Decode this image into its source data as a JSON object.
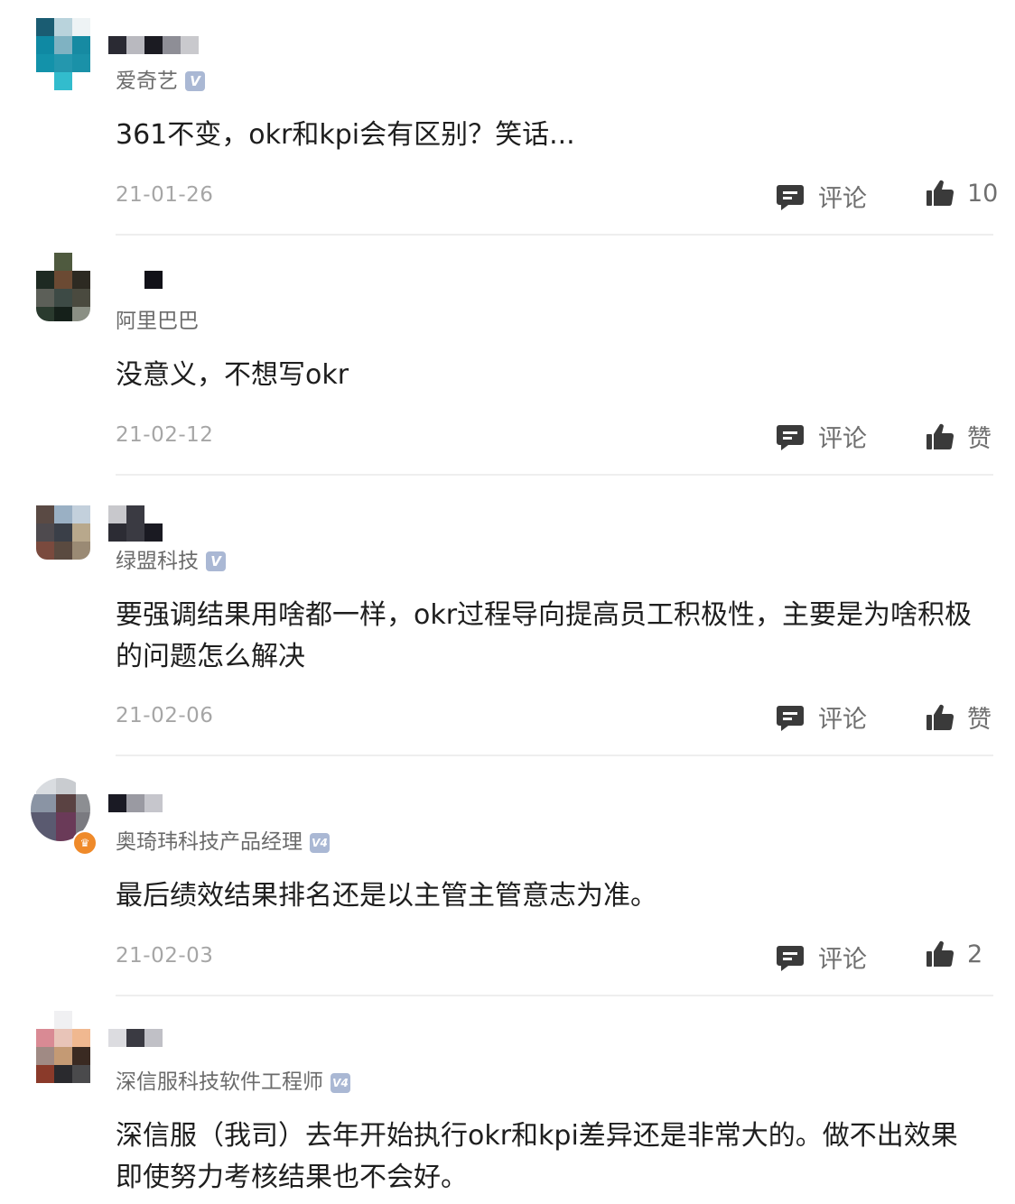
{
  "comments": [
    {
      "company": "爱奇艺",
      "badge": "V",
      "content": "361不变，okr和kpi会有区别？笑话...",
      "date": "21-01-26",
      "comment_label": "评论",
      "like_label": "10"
    },
    {
      "company": "阿里巴巴",
      "badge": "",
      "content": "没意义，不想写okr",
      "date": "21-02-12",
      "comment_label": "评论",
      "like_label": "赞"
    },
    {
      "company": "绿盟科技",
      "badge": "V",
      "content": "要强调结果用啥都一样，okr过程导向提高员工积极性，主要是为啥积极的问题怎么解决",
      "date": "21-02-06",
      "comment_label": "评论",
      "like_label": "赞"
    },
    {
      "company": "奥琦玮科技产品经理",
      "badge": "V4",
      "content": "最后绩效结果排名还是以主管主管意志为准。",
      "date": "21-02-03",
      "comment_label": "评论",
      "like_label": "2"
    },
    {
      "company": "深信服科技软件工程师",
      "badge": "V4",
      "content": "深信服（我司）去年开始执行okr和kpi差异还是非常大的。做不出效果即使努力考核结果也不会好。",
      "date": "",
      "comment_label": "",
      "like_label": ""
    }
  ],
  "colors": {
    "text": "#1e1e1e",
    "muted": "#6b6b6b",
    "date": "#a6a6a6",
    "badge": "#aab8d4",
    "divider": "#eeeeee"
  },
  "icons": {
    "comment": "comment-bubble-icon",
    "like": "thumbs-up-icon",
    "verified": "verified-badge-icon",
    "crown": "crown-icon"
  }
}
